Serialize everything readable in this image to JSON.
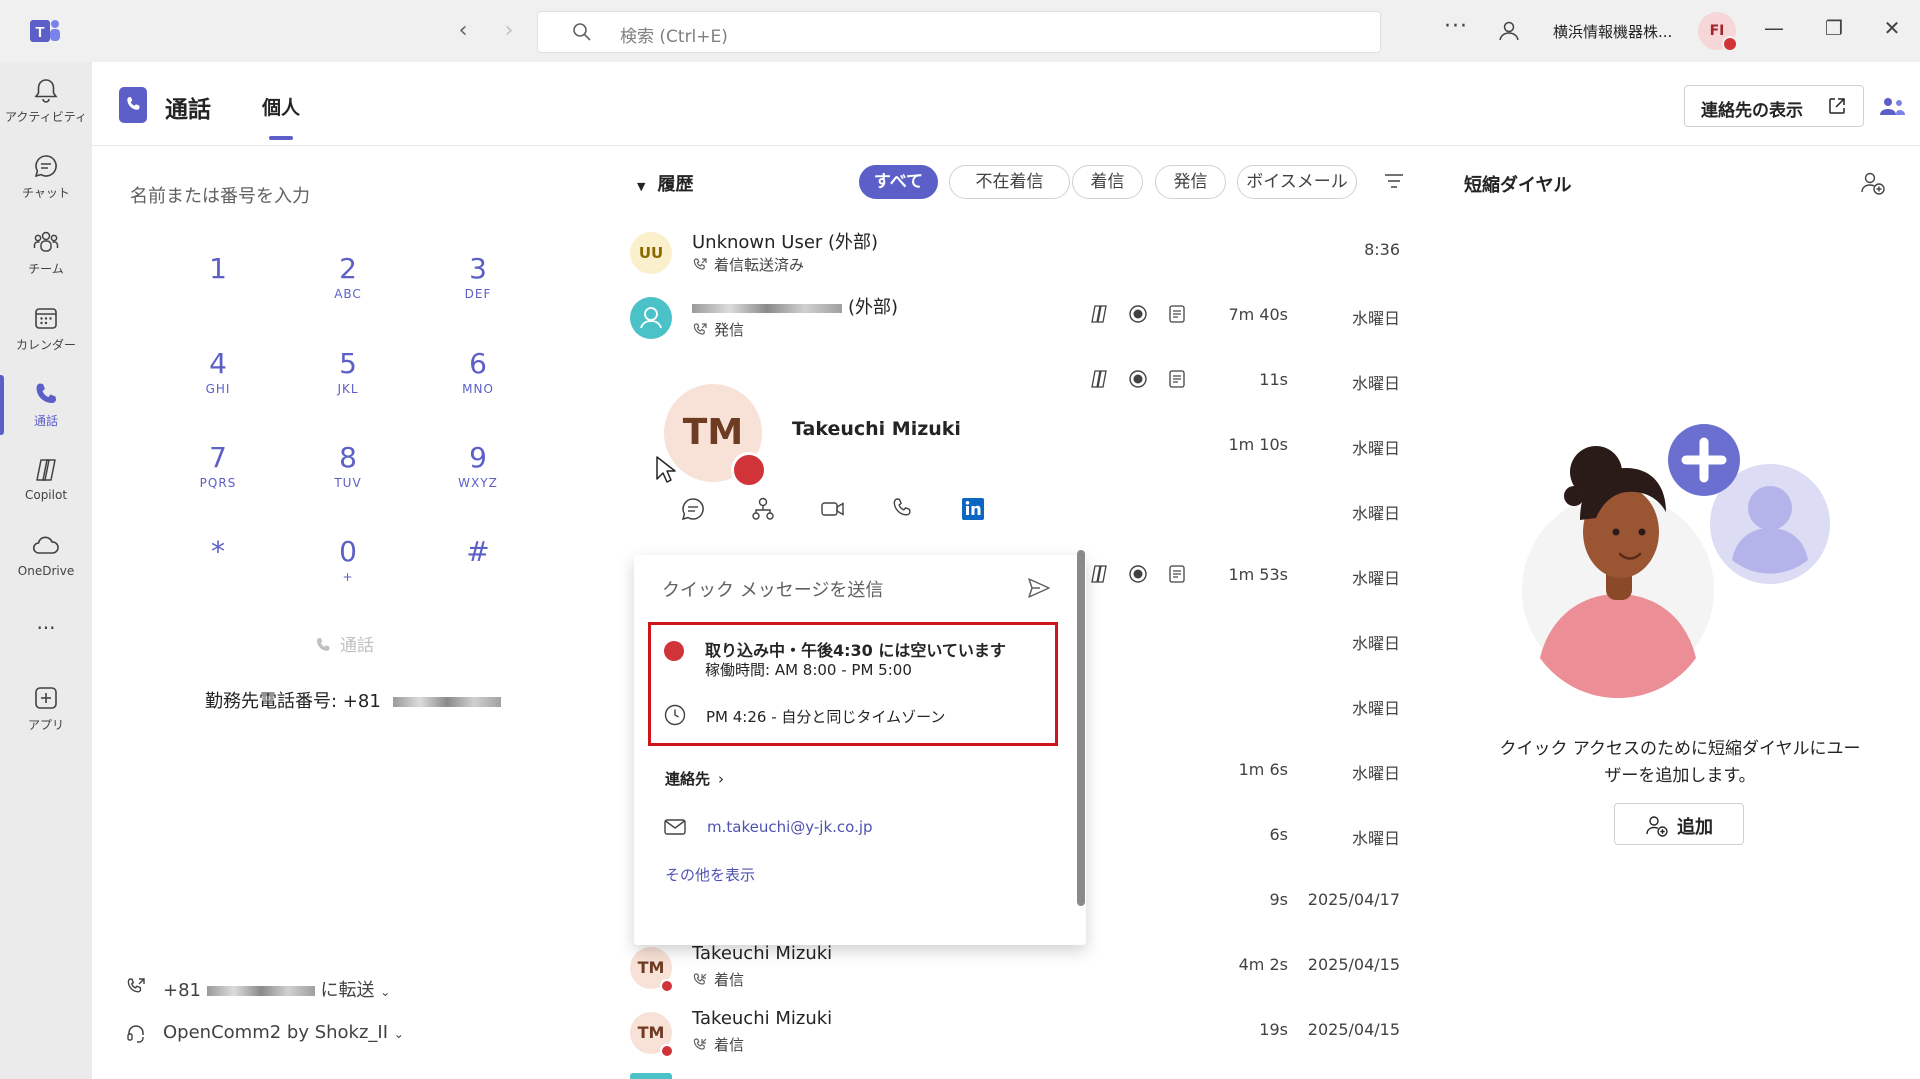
{
  "titlebar": {
    "search_placeholder": "検索 (Ctrl+E)",
    "org_name": "横浜情報機器株...",
    "user_initials": "FI",
    "more": "···"
  },
  "rail": {
    "items": [
      {
        "label": "アクティビティ",
        "icon": "bell-icon"
      },
      {
        "label": "チャット",
        "icon": "chat-icon"
      },
      {
        "label": "チーム",
        "icon": "teams-icon"
      },
      {
        "label": "カレンダー",
        "icon": "calendar-icon"
      },
      {
        "label": "通話",
        "icon": "phone-icon",
        "active": true
      },
      {
        "label": "Copilot",
        "icon": "copilot-icon"
      },
      {
        "label": "OneDrive",
        "icon": "cloud-icon"
      },
      {
        "label": "アプリ",
        "icon": "plus-square-icon"
      }
    ],
    "more": "···"
  },
  "header": {
    "title": "通話",
    "tab": "個人",
    "show_contacts": "連絡先の表示"
  },
  "dialer": {
    "input_placeholder": "名前または番号を入力",
    "keys": [
      {
        "num": "1",
        "sub": ""
      },
      {
        "num": "2",
        "sub": "ABC"
      },
      {
        "num": "3",
        "sub": "DEF"
      },
      {
        "num": "4",
        "sub": "GHI"
      },
      {
        "num": "5",
        "sub": "JKL"
      },
      {
        "num": "6",
        "sub": "MNO"
      },
      {
        "num": "7",
        "sub": "PQRS"
      },
      {
        "num": "8",
        "sub": "TUV"
      },
      {
        "num": "9",
        "sub": "WXYZ"
      },
      {
        "num": "*",
        "sub": ""
      },
      {
        "num": "0",
        "sub": "+"
      },
      {
        "num": "#",
        "sub": ""
      }
    ],
    "call_label": "通話",
    "work_number_label": "勤務先電話番号: +81",
    "forward_prefix": "+81",
    "forward_suffix": "に転送",
    "device": "OpenComm2 by Shokz_II"
  },
  "history": {
    "title": "履歴",
    "filters": [
      "すべて",
      "不在着信",
      "着信",
      "発信",
      "ボイスメール"
    ],
    "rows": [
      {
        "avatar": "UU",
        "name": "Unknown User (外部)",
        "sub": "着信転送済み",
        "duration": "",
        "date": "8:36"
      },
      {
        "avatar": "",
        "name": "(外部)",
        "sub": "発信",
        "duration": "7m 40s",
        "date": "水曜日"
      },
      {
        "avatar": "",
        "name": "",
        "sub": "",
        "duration": "11s",
        "date": "水曜日"
      },
      {
        "avatar": "",
        "name": "",
        "sub": "",
        "duration": "1m 10s",
        "date": "水曜日"
      },
      {
        "avatar": "",
        "name": "",
        "sub": "",
        "duration": "",
        "date": "水曜日"
      },
      {
        "avatar": "",
        "name": "",
        "sub": "",
        "duration": "1m 53s",
        "date": "水曜日"
      },
      {
        "avatar": "",
        "name": "",
        "sub": "",
        "duration": "",
        "date": "水曜日"
      },
      {
        "avatar": "",
        "name": "",
        "sub": "",
        "duration": "",
        "date": "水曜日"
      },
      {
        "avatar": "",
        "name": "",
        "sub": "",
        "duration": "1m 6s",
        "date": "水曜日"
      },
      {
        "avatar": "",
        "name": "",
        "sub": "",
        "duration": "6s",
        "date": "水曜日"
      },
      {
        "avatar": "",
        "name": "",
        "sub": "",
        "duration": "9s",
        "date": "2025/04/17"
      },
      {
        "avatar": "TM",
        "name": "Takeuchi Mizuki",
        "sub": "着信",
        "duration": "4m 2s",
        "date": "2025/04/15"
      },
      {
        "avatar": "TM",
        "name": "Takeuchi Mizuki",
        "sub": "着信",
        "duration": "19s",
        "date": "2025/04/15"
      }
    ]
  },
  "card": {
    "initials": "TM",
    "name": "Takeuchi Mizuki",
    "quick_message": "クイック メッセージを送信",
    "status_main": "取り込み中・午後4:30 には空いています",
    "work_hours": "稼働時間: AM 8:00 - PM 5:00",
    "local_time": "PM 4:26 - 自分と同じタイムゾーン",
    "contact_heading": "連絡先",
    "email": "m.takeuchi@y-jk.co.jp",
    "show_more": "その他を表示"
  },
  "speed_dial": {
    "title": "短縮ダイヤル",
    "description": "クイック アクセスのために短縮ダイヤルにユーザーを追加します。",
    "add_label": "追加"
  },
  "colors": {
    "accent": "#5b5fc7",
    "busy": "#d13438",
    "highlight_box": "#d0141c"
  }
}
